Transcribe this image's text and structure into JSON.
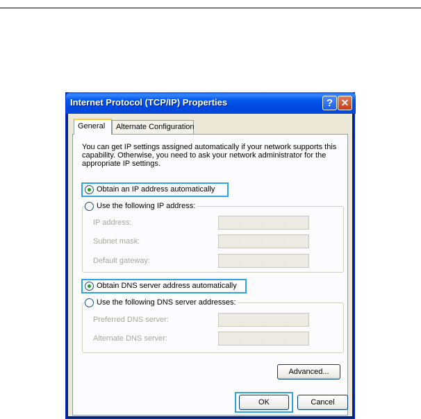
{
  "window": {
    "title": "Internet Protocol (TCP/IP) Properties",
    "help_icon": "?",
    "close_icon": "✕"
  },
  "tabs": [
    {
      "label": "General",
      "selected": true
    },
    {
      "label": "Alternate Configuration",
      "selected": false
    }
  ],
  "description": "You can get IP settings assigned automatically if your network supports this capability. Otherwise, you need to ask your network administrator for the appropriate IP settings.",
  "ip": {
    "auto_label": "Obtain an IP address automatically",
    "auto_selected": true,
    "manual_label": "Use the following IP address:",
    "manual_selected": false,
    "fields": [
      {
        "label": "IP address:",
        "value": ". . ."
      },
      {
        "label": "Subnet mask:",
        "value": ". . ."
      },
      {
        "label": "Default gateway:",
        "value": ". . ."
      }
    ]
  },
  "dns": {
    "auto_label": "Obtain DNS server address automatically",
    "auto_selected": true,
    "manual_label": "Use the following DNS server addresses:",
    "manual_selected": false,
    "fields": [
      {
        "label": "Preferred DNS server:",
        "value": ". . ."
      },
      {
        "label": "Alternate DNS server:",
        "value": ". . ."
      }
    ]
  },
  "buttons": {
    "advanced": "Advanced...",
    "ok": "OK",
    "cancel": "Cancel"
  },
  "colors": {
    "highlight": "#2aa6e3",
    "titlebar": "#0054e3",
    "dialog_bg": "#ece9d8"
  }
}
